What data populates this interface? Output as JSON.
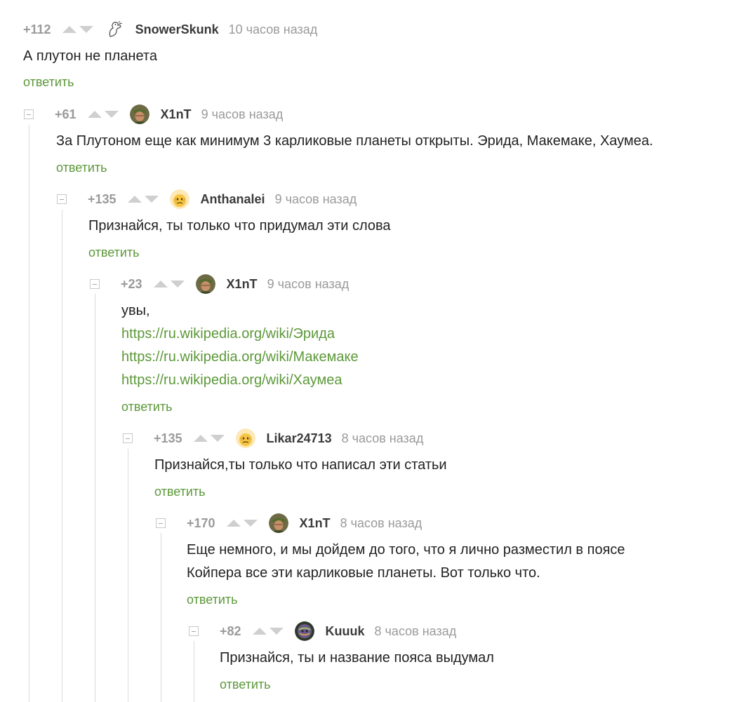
{
  "reply_label": "ответить",
  "colors": {
    "accent_green": "#5c9839",
    "muted_gray": "#9a9a9a",
    "thread_line": "#dadada"
  },
  "comments": [
    {
      "rating": "+112",
      "author": "SnowerSkunk",
      "time": "10 часов назад",
      "avatar_icon": "skunk-outline-icon",
      "lines": [
        "А плутон не планета"
      ],
      "links": []
    },
    {
      "rating": "+61",
      "author": "X1nT",
      "time": "9 часов назад",
      "avatar_icon": "soldier-avatar",
      "lines": [
        "За Плутоном еще как минимум 3 карликовые планеты открыты. Эрида, Макемаке, Хаумеа."
      ],
      "links": []
    },
    {
      "rating": "+135",
      "author": "Anthanalei",
      "time": "9 часов назад",
      "avatar_icon": "emoji-avatar",
      "lines": [
        "Признайся, ты только что придумал эти слова"
      ],
      "links": []
    },
    {
      "rating": "+23",
      "author": "X1nT",
      "time": "9 часов назад",
      "avatar_icon": "soldier-avatar",
      "lines": [
        "увы,"
      ],
      "links": [
        "https://ru.wikipedia.org/wiki/Эрида",
        "https://ru.wikipedia.org/wiki/Макемаке",
        "https://ru.wikipedia.org/wiki/Хаумеа"
      ]
    },
    {
      "rating": "+135",
      "author": "Likar24713",
      "time": "8 часов назад",
      "avatar_icon": "emoji-avatar",
      "lines": [
        "Признайся,ты только что написал эти статьи"
      ],
      "links": []
    },
    {
      "rating": "+170",
      "author": "X1nT",
      "time": "8 часов назад",
      "avatar_icon": "soldier-avatar",
      "lines": [
        "Еще немного, и мы дойдем до того, что я лично разместил в поясе",
        "Койпера все эти карликовые планеты. Вот только что."
      ],
      "links": []
    },
    {
      "rating": "+82",
      "author": "Kuuuk",
      "time": "8 часов назад",
      "avatar_icon": "planet-avatar",
      "lines": [
        "Признайся, ты и название пояса выдумал"
      ],
      "links": []
    }
  ]
}
